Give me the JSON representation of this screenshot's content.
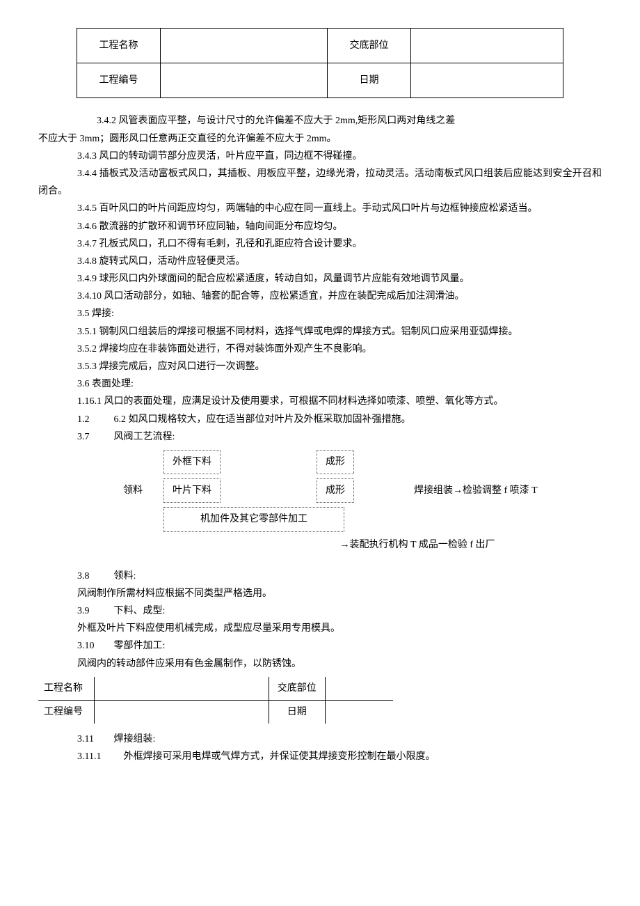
{
  "header": {
    "r1c1": "工程名称",
    "r1c3": "交底部位",
    "r2c1": "工程编号",
    "r2c3": "日期"
  },
  "paragraphs": {
    "p342": "3.4.2 风管表面应平整，与设计尺寸的允许偏差不应大于 2mm,矩形风口两对角线之差",
    "p342b": "不应大于 3mm；圆形风口任意两正交直径的允许偏差不应大于 2mm。",
    "p343": "3.4.3 风口的转动调节部分应灵活，叶片应平直，同边框不得碰撞。",
    "p344": "3.4.4 插板式及活动富板式风口，其插板、用板应平整，边缘光滑，拉动灵活。活动南板式风口组装后应能达到安全开召和闭合。",
    "p345": "3.4.5 百叶风口的叶片间距应均匀，两端轴的中心应在同一直线上。手动式风口叶片与边框钟接应松紧适当。",
    "p346": "3.4.6 散流器的扩散环和调节环应同轴，轴向间距分布应均匀。",
    "p347": "3.4.7 孔板式风口，孔口不得有毛剌，孔径和孔距应符合设计要求。",
    "p348": "3.4.8 旋转式风口，活动件应轻便灵活。",
    "p349": "3.4.9 球形风口内外球面间的配合应松紧适度，转动自如，风量调节片应能有效地调节风量。",
    "p3410": "3.4.10 风口活动部分，如轴、轴套的配合等，应松紧适宜，并应在装配完成后加注润滑油。",
    "p35": "3.5 焊接:",
    "p351": "3.5.1 钢制风口组装后的焊接可根据不同材料，选择气焊或电焊的焊接方式。铝制风口应采用亚弧焊接。",
    "p352": "3.5.2 焊接均应在非装饰面处进行，不得对装饰面外观产生不良影响。",
    "p353": "3.5.3 焊接完成后，应对风口进行一次调整。",
    "p36": "3.6 表面处理:",
    "p1161": "1.16.1 风口的表面处理，应满足设计及使用要求，可根据不同材料选择如喷漆、喷塑、氧化等方式。",
    "p12num": "1.2",
    "p12txt": "6.2 如风口规格较大，应在适当部位对叶片及外框采取加固补强措施。",
    "p37num": "3.7",
    "p37txt": "风阀工艺流程:",
    "p38num": "3.8",
    "p38txt": "领料:",
    "p38b": "风阀制作所需材料应根据不同类型严格选用。",
    "p39num": "3.9",
    "p39txt": "下料、成型:",
    "p39b": "外框及叶片下料应使用机械完成，成型应尽量采用专用模具。",
    "p310num": "3.10",
    "p310txt": "零部件加工:",
    "p310b": "风阀内的转动部件应采用有色金属制作，以防锈蚀。",
    "p311num": "3.11",
    "p311txt": "焊接组装:",
    "p3111num": "3.11.1",
    "p3111txt": "外框焊接可采用电焊或气焊方式，并保证使其焊接变形控制在最小限度。"
  },
  "flow": {
    "lingliao": "领料",
    "box1": "外框下料",
    "box2": "叶片下料",
    "box3": "成形",
    "box4": "成形",
    "box5": "机加件及其它零部件加工",
    "right": "焊接组装→检验调整 f 喷漆 T",
    "caption": "→装配执行机构 T 成品一检验 f 出厂"
  },
  "inner_table": {
    "r1c1": "工程名称",
    "r1c2": "交底部位",
    "r2c1": "工程编号",
    "r2c2": "日期"
  }
}
